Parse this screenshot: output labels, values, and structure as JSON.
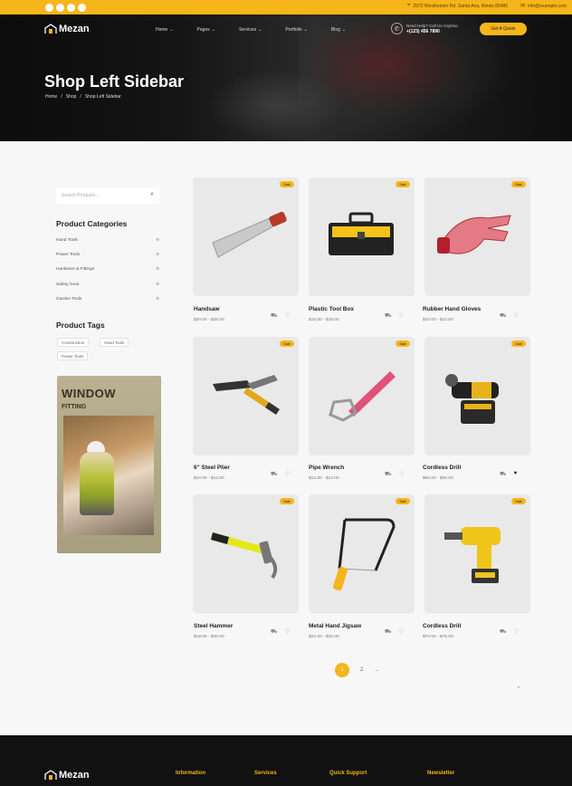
{
  "topbar": {
    "social_icons": [
      "facebook-icon",
      "twitter-icon",
      "instagram-icon",
      "linkedin-icon"
    ],
    "address": "2972 Westheimer Rd. Santa Ana, Illinois 85486",
    "email": "info@example.com"
  },
  "header": {
    "logo": "Mezan",
    "nav": [
      "Home",
      "Pages",
      "Services",
      "Portfolio",
      "Blog"
    ],
    "contact_label": "Need Help? Call Us Anytime",
    "contact_phone": "+(123) 456 7890",
    "quote_button": "Get A Quote"
  },
  "hero": {
    "title": "Shop Left Sidebar",
    "breadcrumb": [
      "Home",
      "/",
      "Shop",
      "/",
      "Shop Left Sidebar"
    ]
  },
  "sidebar": {
    "search_placeholder": "Search Products...",
    "categories_title": "Product Categories",
    "categories": [
      "Hand Tools",
      "Power Tools",
      "Hardware & Fittings",
      "Safety Gear",
      "Garden Tools"
    ],
    "tags_title": "Product Tags",
    "tags": [
      "Construction",
      "Hand Tools",
      "Power Tools"
    ],
    "banner": {
      "title": "WINDOW",
      "subtitle": "FITTING"
    }
  },
  "products": [
    {
      "name": "Handsaw",
      "price": "$20.00 - $25.00",
      "badge": "Sale"
    },
    {
      "name": "Plastic Tool Box",
      "price": "$15.00 - $18.00",
      "badge": "Sale"
    },
    {
      "name": "Rubber Hand Gloves",
      "price": "$10.00 - $12.00",
      "badge": "Sale"
    },
    {
      "name": "6\" Steel Plier",
      "price": "$10.00 - $12.00",
      "badge": "Sale"
    },
    {
      "name": "Pipe Wrench",
      "price": "$12.00 - $14.00",
      "badge": "Sale"
    },
    {
      "name": "Cordless Drill",
      "price": "$60.00 - $65.00",
      "badge": "Sale"
    },
    {
      "name": "Steel Hammer",
      "price": "$18.00 - $20.00",
      "badge": "Sale"
    },
    {
      "name": "Metal Hand Jigsaw",
      "price": "$22.00 - $25.00",
      "badge": "Sale"
    },
    {
      "name": "Cordless Drill",
      "price": "$70.00 - $75.00",
      "badge": "Sale"
    }
  ],
  "pagination": {
    "pages": [
      "1",
      "2",
      "→"
    ]
  },
  "footer": {
    "logo": "Mezan",
    "headings": [
      "Information",
      "Services",
      "Quick Support",
      "Newsletter"
    ]
  },
  "colors": {
    "accent": "#f6b51a",
    "dark": "#111111"
  }
}
